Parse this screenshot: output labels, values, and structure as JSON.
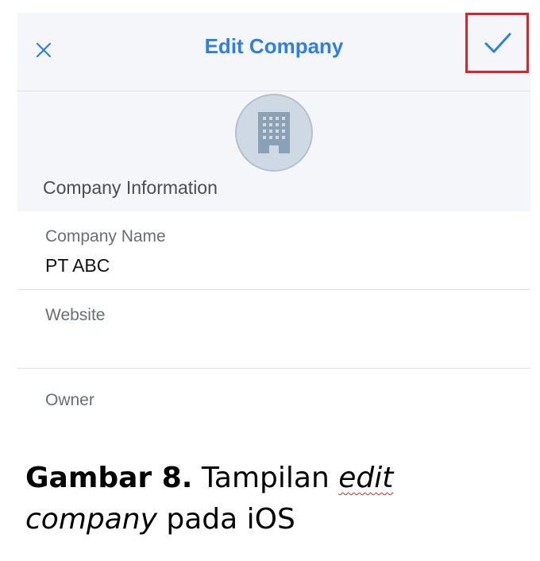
{
  "navbar": {
    "close_icon": "close-icon",
    "title": "Edit Company",
    "confirm_icon": "checkmark-icon",
    "accent_color": "#2f7fe0"
  },
  "header": {
    "avatar_icon": "building-icon",
    "section_title": "Company Information"
  },
  "fields": [
    {
      "label": "Company Name",
      "value": "PT ABC"
    },
    {
      "label": "Website",
      "value": ""
    },
    {
      "label": "Owner",
      "value": ""
    }
  ],
  "caption": {
    "figure": "Gambar 8.",
    "text1": "Tampilan",
    "text2": "edit",
    "text3": "company",
    "text4": "pada iOS"
  },
  "highlight_color": "#d6262b"
}
